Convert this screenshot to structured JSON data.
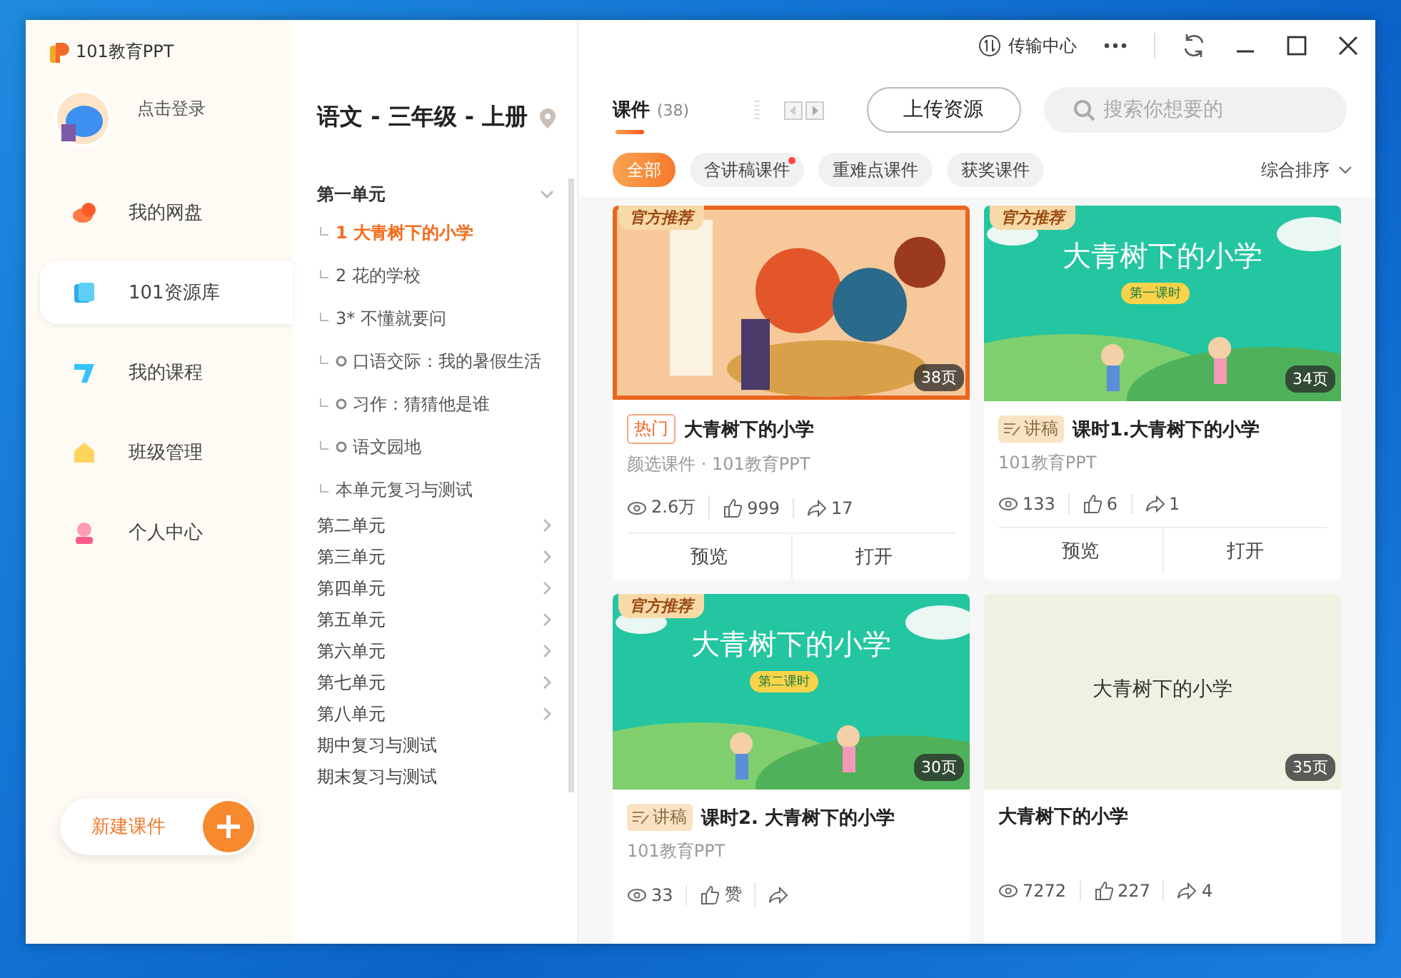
{
  "app": {
    "logo_text": "101教育PPT",
    "login": "点击登录"
  },
  "titlebar": {
    "transfer": "传输中心"
  },
  "nav": [
    {
      "label": "我的网盘",
      "selected": false
    },
    {
      "label": "101资源库",
      "selected": true
    },
    {
      "label": "我的课程",
      "selected": false
    },
    {
      "label": "班级管理",
      "selected": false
    },
    {
      "label": "个人中心",
      "selected": false
    }
  ],
  "new_button": "新建课件",
  "book": {
    "title": "语文 - 三年级 - 上册"
  },
  "tree": [
    {
      "label": "第一单元",
      "expanded": true,
      "children": [
        {
          "label": "1 大青树下的小学",
          "kind": "lesson",
          "selected": true
        },
        {
          "label": "2 花的学校",
          "kind": "lesson",
          "selected": false
        },
        {
          "label": "3* 不懂就要问",
          "kind": "lesson",
          "selected": false
        },
        {
          "label": "口语交际：我的暑假生活",
          "kind": "activity",
          "selected": false
        },
        {
          "label": "习作：猜猜他是谁",
          "kind": "activity",
          "selected": false
        },
        {
          "label": "语文园地",
          "kind": "activity",
          "selected": false
        },
        {
          "label": "本单元复习与测试",
          "kind": "lesson",
          "selected": false
        }
      ]
    },
    {
      "label": "第二单元",
      "expanded": false
    },
    {
      "label": "第三单元",
      "expanded": false
    },
    {
      "label": "第四单元",
      "expanded": false
    },
    {
      "label": "第五单元",
      "expanded": false
    },
    {
      "label": "第六单元",
      "expanded": false
    },
    {
      "label": "第七单元",
      "expanded": false
    },
    {
      "label": "第八单元",
      "expanded": false
    },
    {
      "label": "期中复习与测试"
    },
    {
      "label": "期末复习与测试"
    }
  ],
  "tab": {
    "label": "课件",
    "count": "(38)",
    "selected": true
  },
  "upload": "上传资源",
  "search": {
    "placeholder": "搜索你想要的"
  },
  "filters": [
    {
      "label": "全部",
      "selected": true,
      "dot": false
    },
    {
      "label": "含讲稿课件",
      "selected": false,
      "dot": true
    },
    {
      "label": "重难点课件",
      "selected": false,
      "dot": false
    },
    {
      "label": "获奖课件",
      "selected": false,
      "dot": false
    }
  ],
  "sort": "综合排序",
  "cards": [
    {
      "official": "官方推荐",
      "pages": "38页",
      "tag": {
        "kind": "hot",
        "label": "热门"
      },
      "title": "大青树下的小学",
      "source": "颜选课件 · 101教育PPT",
      "views": "2.6万",
      "likes": "999",
      "shares": "17",
      "actions": [
        "预览",
        "打开"
      ]
    },
    {
      "official": "官方推荐",
      "thumb_title": "大青树下的小学",
      "thumb_sub": "第一课时",
      "pages": "34页",
      "tag": {
        "kind": "script",
        "label": "讲稿"
      },
      "title": "课时1.大青树下的小学",
      "source": "101教育PPT",
      "views": "133",
      "likes": "6",
      "shares": "1",
      "actions": [
        "预览",
        "打开"
      ]
    },
    {
      "official": "官方推荐",
      "thumb_title": "大青树下的小学",
      "thumb_sub": "第二课时",
      "pages": "30页",
      "tag": {
        "kind": "script",
        "label": "讲稿"
      },
      "title": "课时2. 大青树下的小学",
      "source": "101教育PPT",
      "views": "33",
      "likes": "赞"
    },
    {
      "thumb_title": "大青树下的小学",
      "pages": "35页",
      "title": "大青树下的小学",
      "views": "7272",
      "likes": "227",
      "shares": "4"
    }
  ]
}
